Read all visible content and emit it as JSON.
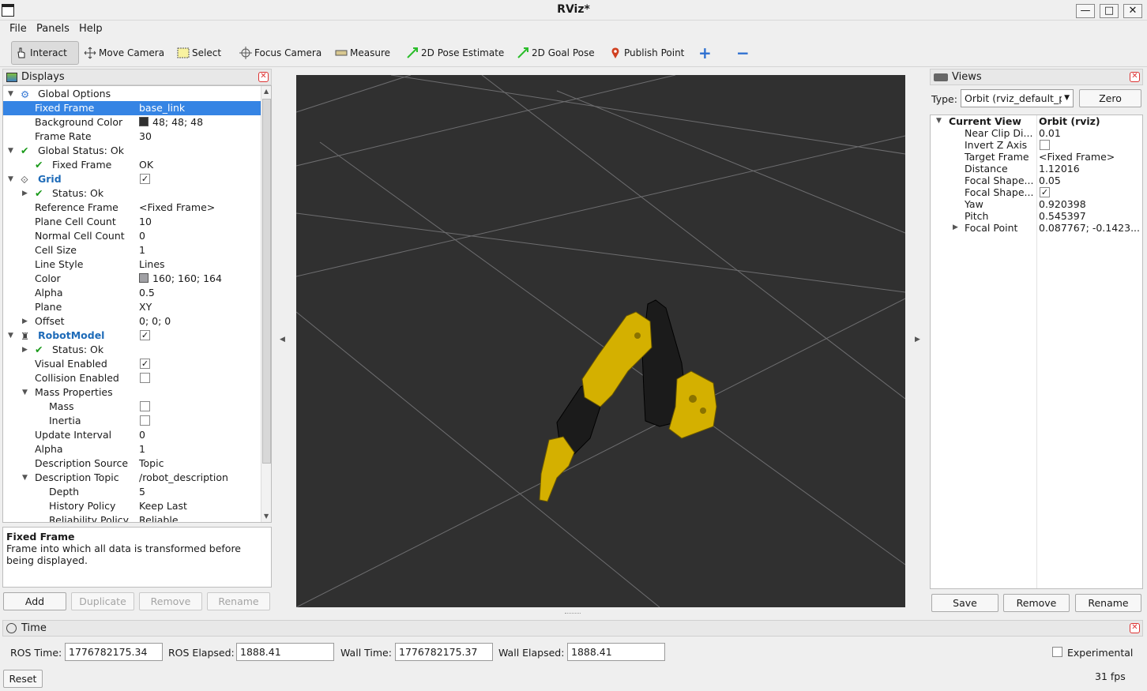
{
  "window": {
    "title": "RViz*",
    "minimize": "—",
    "maximize": "□",
    "close": "✕"
  },
  "menu": {
    "file": "File",
    "panels": "Panels",
    "help": "Help"
  },
  "toolbar": {
    "interact": "Interact",
    "move_camera": "Move Camera",
    "select": "Select",
    "focus_camera": "Focus Camera",
    "measure": "Measure",
    "pose_estimate": "2D Pose Estimate",
    "goal_pose": "2D Goal Pose",
    "publish_point": "Publish Point",
    "add_tool": "+",
    "remove_tool": "−"
  },
  "displays": {
    "title": "Displays",
    "rows": [
      {
        "name": "Global Options",
        "value": ""
      },
      {
        "name": "Fixed Frame",
        "value": "base_link"
      },
      {
        "name": "Background Color",
        "value": "48; 48; 48"
      },
      {
        "name": "Frame Rate",
        "value": "30"
      },
      {
        "name": "Global Status: Ok",
        "value": ""
      },
      {
        "name": "Fixed Frame",
        "value": "OK"
      },
      {
        "name": "Grid",
        "value": ""
      },
      {
        "name": "Status: Ok",
        "value": ""
      },
      {
        "name": "Reference Frame",
        "value": "<Fixed Frame>"
      },
      {
        "name": "Plane Cell Count",
        "value": "10"
      },
      {
        "name": "Normal Cell Count",
        "value": "0"
      },
      {
        "name": "Cell Size",
        "value": "1"
      },
      {
        "name": "Line Style",
        "value": "Lines"
      },
      {
        "name": "Color",
        "value": "160; 160; 164"
      },
      {
        "name": "Alpha",
        "value": "0.5"
      },
      {
        "name": "Plane",
        "value": "XY"
      },
      {
        "name": "Offset",
        "value": "0; 0; 0"
      },
      {
        "name": "RobotModel",
        "value": ""
      },
      {
        "name": "Status: Ok",
        "value": ""
      },
      {
        "name": "Visual Enabled",
        "value": ""
      },
      {
        "name": "Collision Enabled",
        "value": ""
      },
      {
        "name": "Mass Properties",
        "value": ""
      },
      {
        "name": "Mass",
        "value": ""
      },
      {
        "name": "Inertia",
        "value": ""
      },
      {
        "name": "Update Interval",
        "value": "0"
      },
      {
        "name": "Alpha",
        "value": "1"
      },
      {
        "name": "Description Source",
        "value": "Topic"
      },
      {
        "name": "Description Topic",
        "value": "/robot_description"
      },
      {
        "name": "Depth",
        "value": "5"
      },
      {
        "name": "History Policy",
        "value": "Keep Last"
      },
      {
        "name": "Reliability Policy",
        "value": "Reliable"
      }
    ],
    "desc_title": "Fixed Frame",
    "desc_text": "Frame into which all data is transformed before being displayed.",
    "buttons": {
      "add": "Add",
      "duplicate": "Duplicate",
      "remove": "Remove",
      "rename": "Rename"
    },
    "bg_color": "#303030",
    "grid_color": "#a0a0a4"
  },
  "views": {
    "title": "Views",
    "type_label": "Type:",
    "type_value": "Orbit (rviz_default_p",
    "zero": "Zero",
    "rows": [
      {
        "name": "Current View",
        "value": "Orbit (rviz)"
      },
      {
        "name": "Near Clip Di...",
        "value": "0.01"
      },
      {
        "name": "Invert Z Axis",
        "value": ""
      },
      {
        "name": "Target Frame",
        "value": "<Fixed Frame>"
      },
      {
        "name": "Distance",
        "value": "1.12016"
      },
      {
        "name": "Focal Shape...",
        "value": "0.05"
      },
      {
        "name": "Focal Shape...",
        "value": ""
      },
      {
        "name": "Yaw",
        "value": "0.920398"
      },
      {
        "name": "Pitch",
        "value": "0.545397"
      },
      {
        "name": "Focal Point",
        "value": "0.087767; -0.1423..."
      }
    ],
    "buttons": {
      "save": "Save",
      "remove": "Remove",
      "rename": "Rename"
    }
  },
  "time": {
    "title": "Time",
    "ros_time_label": "ROS Time:",
    "ros_time": "1776782175.34",
    "ros_elapsed_label": "ROS Elapsed:",
    "ros_elapsed": "1888.41",
    "wall_time_label": "Wall Time:",
    "wall_time": "1776782175.37",
    "wall_elapsed_label": "Wall Elapsed:",
    "wall_elapsed": "1888.41",
    "experimental": "Experimental",
    "reset": "Reset",
    "fps": "31 fps"
  }
}
